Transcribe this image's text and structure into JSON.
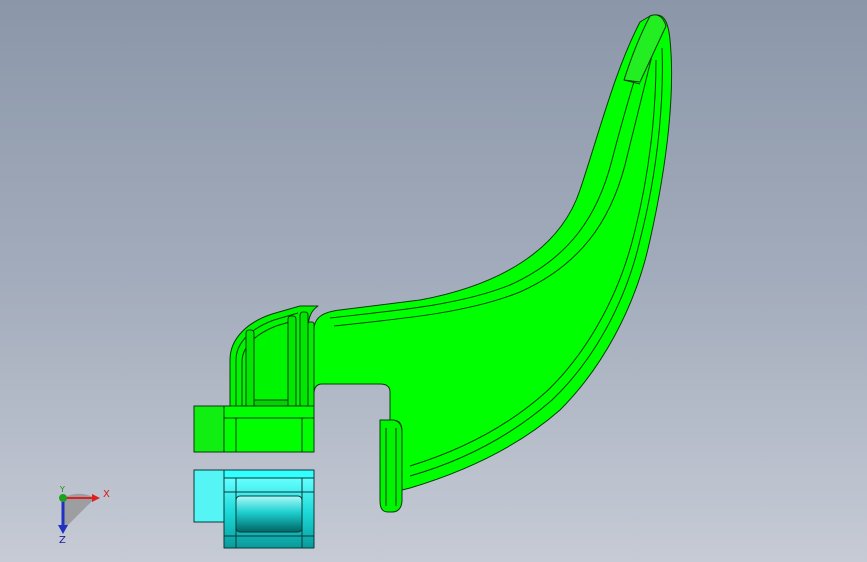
{
  "viewport": {
    "background_top": "#8b97a9",
    "background_bottom": "#c6cbd5"
  },
  "model": {
    "body_color": "#00ff00",
    "edge_color": "#0a3a0a",
    "lower_part_color": "#33ffff"
  },
  "triad": {
    "x_label": "X",
    "y_label": "Y",
    "z_label": "Z",
    "x_color": "#e02020",
    "y_color": "#20a020",
    "z_color": "#2030c0"
  }
}
